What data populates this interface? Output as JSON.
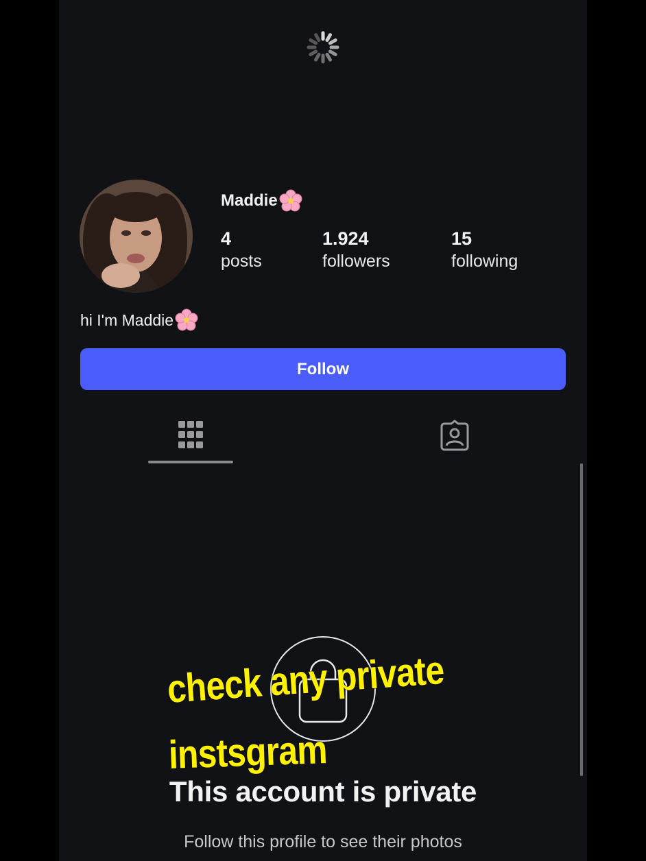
{
  "profile": {
    "username": "Maddie",
    "bio": "hi I'm Maddie",
    "stats": [
      {
        "value": "4",
        "label": "posts"
      },
      {
        "value": "1.924",
        "label": "followers"
      },
      {
        "value": "15",
        "label": "following"
      }
    ],
    "follow_label": "Follow"
  },
  "tabs": {
    "grid": "grid-icon",
    "tagged": "tagged-person-icon"
  },
  "private": {
    "title": "This account is private",
    "subtitle": "Follow this profile to see their photos"
  },
  "overlay": {
    "line1": "check any private",
    "line2": "instsgram"
  },
  "colors": {
    "background": "#111216",
    "follow_button": "#4a5dfa",
    "overlay_text": "#fff200"
  }
}
